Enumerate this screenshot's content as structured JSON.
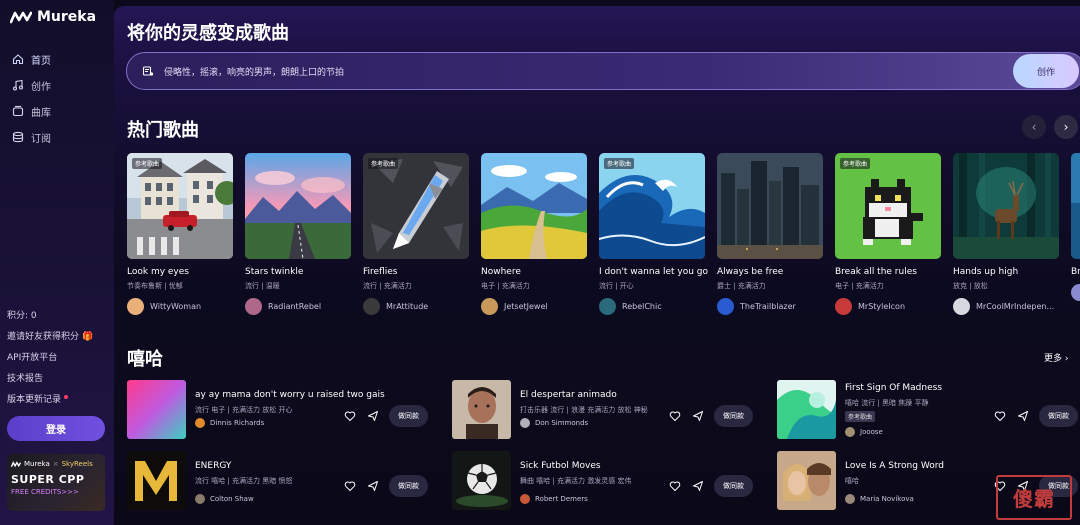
{
  "app": {
    "name": "Mureka"
  },
  "sidebar": {
    "nav": [
      {
        "label": "首页",
        "icon": "home-icon",
        "active": true
      },
      {
        "label": "创作",
        "icon": "music-note-icon",
        "active": false
      },
      {
        "label": "曲库",
        "icon": "library-icon",
        "active": false
      },
      {
        "label": "订阅",
        "icon": "subscription-icon",
        "active": false
      }
    ],
    "credits": "积分: 0",
    "invite": "邀请好友获得积分",
    "api": "API开放平台",
    "report": "技术报告",
    "changelog": "版本更新记录",
    "login": "登录",
    "promo": {
      "brand": "Mureka",
      "partner": "SkyReels",
      "title": "SUPER CPP",
      "subtitle": "FREE CREDITS>>>"
    }
  },
  "main": {
    "headline": "将你的灵感变成歌曲",
    "prompt": {
      "placeholder": "侵略性，摇滚，响亮的男声，朗朗上口的节拍",
      "create": "创作"
    },
    "hot": {
      "title": "热门歌曲"
    },
    "hiphop": {
      "title": "嘻哈",
      "more": "更多"
    }
  },
  "colors": {
    "accent": "#6a4cd8",
    "background": "#0c0a1a"
  },
  "hot_songs": [
    {
      "title": "Look my eyes",
      "tags": "节奏布鲁斯 | 忧郁",
      "user": "WittyWoman",
      "ref": "参考歌曲",
      "avatar": "#e9b07a"
    },
    {
      "title": "Stars twinkle",
      "tags": "流行 | 温暖",
      "user": "RadiantRebel",
      "ref": "",
      "avatar": "#b0688a"
    },
    {
      "title": "Fireflies",
      "tags": "流行 | 充满活力",
      "user": "MrAttitude",
      "ref": "参考歌曲",
      "avatar": "#3a3a3a"
    },
    {
      "title": "Nowhere",
      "tags": "电子 | 充满活力",
      "user": "JetsetJewel",
      "ref": "",
      "avatar": "#c89a5a"
    },
    {
      "title": "I don't wanna let you go",
      "tags": "流行 | 开心",
      "user": "RebelChic",
      "ref": "参考歌曲",
      "avatar": "#2a6a7a"
    },
    {
      "title": "Always be free",
      "tags": "爵士 | 充满活力",
      "user": "TheTrailblazer",
      "ref": "",
      "avatar": "#2a5ad0"
    },
    {
      "title": "Break all the rules",
      "tags": "电子 | 充满活力",
      "user": "MrStyleIcon",
      "ref": "参考歌曲",
      "avatar": "#c83a3a"
    },
    {
      "title": "Hands up high",
      "tags": "放克 | 放松",
      "user": "MrCoolMrIndepen...",
      "ref": "",
      "avatar": "#d8d8e0"
    },
    {
      "title": "Bre",
      "tags": "",
      "user": "",
      "ref": "",
      "avatar": "#8a8ad0"
    }
  ],
  "hiphop_tracks": [
    {
      "title": "ay ay mama don't worry u raised two gais",
      "tags": "流行 电子 | 充满活力 放松 开心",
      "user": "Dinnis Richards",
      "avatar": "#e08a2a",
      "badge": "",
      "same": "做同款"
    },
    {
      "title": "El despertar animado",
      "tags": "打击乐器 流行 | 浪漫 充满活力 放松 神秘",
      "user": "Don Simmonds",
      "avatar": "#b0b0b8",
      "badge": "",
      "same": "做同款"
    },
    {
      "title": "First Sign Of Madness",
      "tags": "嘻哈 流行 | 黑暗 焦躁 平静",
      "user": "Jooose",
      "avatar": "#a09070",
      "badge": "参考歌曲",
      "same": "做同款"
    },
    {
      "title": "ENERGY",
      "tags": "流行 嘻哈 | 充满活力 黑暗 愤怒",
      "user": "Colton Shaw",
      "avatar": "#8a7a6a",
      "badge": "",
      "same": "做同款"
    },
    {
      "title": "Sick Futbol Moves",
      "tags": "舞曲 嘻哈 | 充满活力 激发灵感 宏伟",
      "user": "Robert Demers",
      "avatar": "#c85a3a",
      "badge": "",
      "same": "做同款"
    },
    {
      "title": "Love Is A Strong Word",
      "tags": "嘻哈",
      "user": "Maria Novikova",
      "avatar": "#9a8a7a",
      "badge": "",
      "same": "做同款"
    }
  ],
  "watermark": "傻霸"
}
